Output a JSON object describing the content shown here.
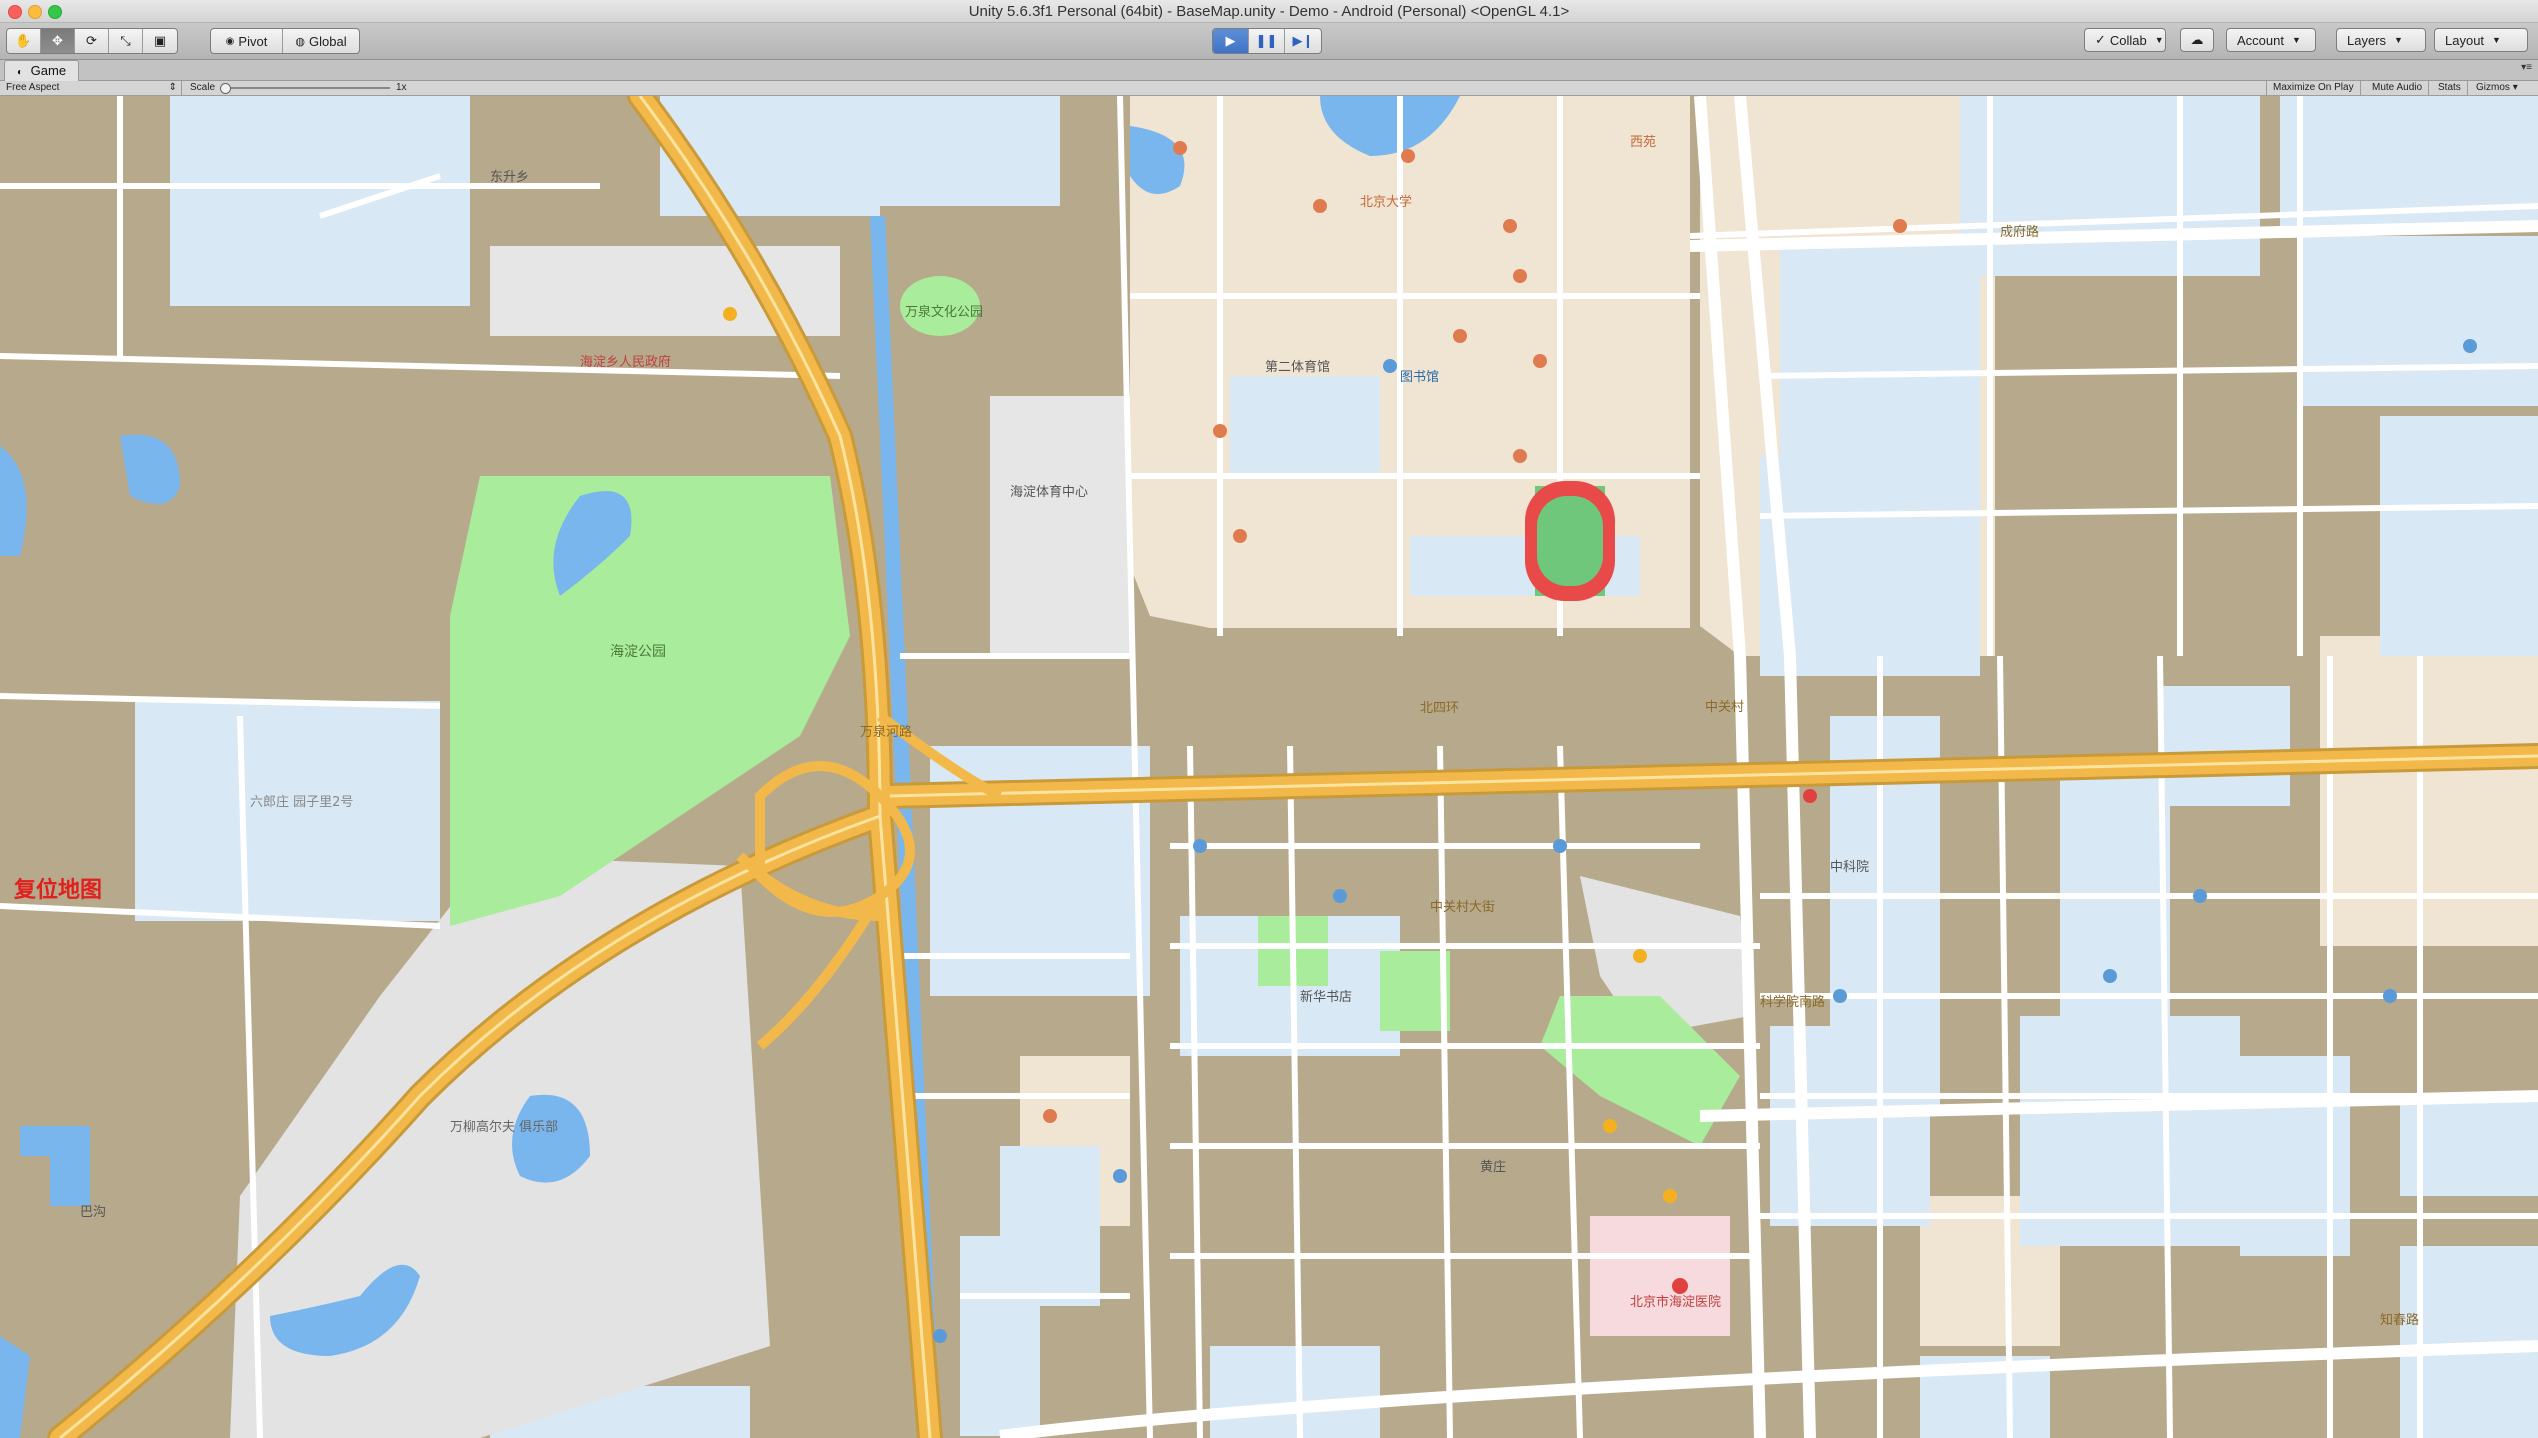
{
  "window": {
    "title": "Unity 5.6.3f1 Personal (64bit) - BaseMap.unity - Demo - Android (Personal) <OpenGL 4.1>"
  },
  "toolbar": {
    "pivot_label": "Pivot",
    "global_label": "Global",
    "collab_label": "Collab",
    "account_label": "Account",
    "layers_label": "Layers",
    "layout_label": "Layout"
  },
  "game_view": {
    "tab_label": "Game",
    "aspect_label": "Free Aspect",
    "scale_label": "Scale",
    "scale_value": "1x",
    "maximize_label": "Maximize On Play",
    "mute_label": "Mute Audio",
    "stats_label": "Stats",
    "gizmos_label": "Gizmos"
  },
  "map": {
    "reset_button": "复位地图",
    "labels": {
      "peking_university": "北京大学",
      "haidian_park": "海淀公园",
      "wanquan_park": "万泉文化公园",
      "liulangzhuang": "六郎庄\n园子里2号",
      "wanliu_golf": "万柳高尔夫\n俱乐部",
      "haidian_hospital": "北京市海淀医院",
      "ict": "中科院",
      "library": "图书馆",
      "north_4th_ring": "北四环",
      "zhongguancun": "中关村",
      "chengfu_rd": "成府路",
      "kexueyuan_south": "科学院南路",
      "wanquanhe_rd": "万泉河路",
      "haidian_sports": "海淀体育中心",
      "stadium": "第二体育馆",
      "xinhua": "新华书店",
      "zhongguancun_road": "中关村大街",
      "zhichun_road": "知春路",
      "huangzhuang": "黄庄",
      "renmin_gov": "海淀乡人民政府",
      "dongsheng": "东升乡",
      "bagua": "巴沟",
      "xiyuan": "西苑"
    }
  },
  "colors": {
    "block": "#b7a98b",
    "road": "#ffffff",
    "highway": "#f3b84a",
    "campus": "#f0e4d2",
    "residential": "#d8e8f5",
    "park": "#a9ec9b",
    "water": "#79b6ee",
    "reset_text": "#e0201e"
  }
}
